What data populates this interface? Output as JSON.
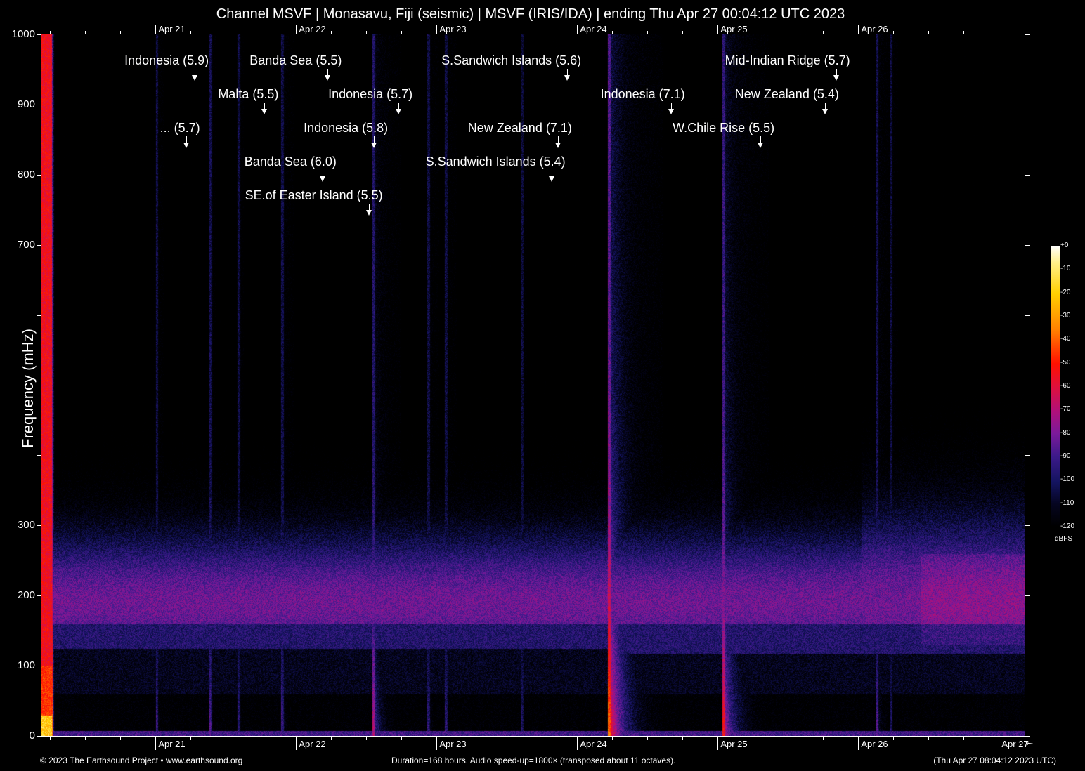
{
  "chart_data": {
    "type": "heatmap",
    "subtype": "spectrogram",
    "title": "Channel MSVF | Monasavu, Fiji (seismic) | MSVF (IRIS/IDA) | ending Thu Apr 27 00:04:12 UTC 2023",
    "ylabel": "Frequency (mHz)",
    "ylim": [
      0,
      1000
    ],
    "yticks": [
      0,
      100,
      200,
      300,
      400,
      500,
      600,
      700,
      800,
      900,
      1000
    ],
    "ytick_labels": [
      "0",
      "100",
      "200",
      "300",
      "",
      "",
      "",
      "700",
      "800",
      "900",
      "1000"
    ],
    "duration_hours": 168,
    "xticks_top": [
      "Apr 21",
      "Apr 22",
      "Apr 23",
      "Apr 24",
      "Apr 25",
      "Apr 26"
    ],
    "xticks_bottom": [
      "Apr 21",
      "Apr 22",
      "Apr 23",
      "Apr 24",
      "Apr 25",
      "Apr 26",
      "Apr 27"
    ],
    "xtick_hours": [
      19.6,
      43.6,
      67.6,
      91.6,
      115.6,
      139.6,
      163.6
    ],
    "colorbar": {
      "label": "dBFS",
      "range": [
        -120,
        0
      ],
      "ticks": [
        "+0",
        "-10",
        "-20",
        "-30",
        "-40",
        "-50",
        "-60",
        "-70",
        "-80",
        "-90",
        "-100",
        "-110",
        "-120"
      ]
    },
    "events": [
      {
        "label": "Indonesia (5.9)",
        "hour": 26.3
      },
      {
        "label": "Banda Sea (5.5)",
        "hour": 49.0
      },
      {
        "label": "S.Sandwich Islands (5.6)",
        "hour": 89.9
      },
      {
        "label": "Mid-Indian Ridge (5.7)",
        "hour": 135.8
      },
      {
        "label": "Malta (5.5)",
        "hour": 38.2
      },
      {
        "label": "Indonesia (5.7)",
        "hour": 61.1
      },
      {
        "label": "Indonesia (7.1)",
        "hour": 107.6
      },
      {
        "label": "New Zealand (5.4)",
        "hour": 133.9
      },
      {
        "label": "... (5.7)",
        "hour": 24.8
      },
      {
        "label": "Indonesia (5.8)",
        "hour": 56.9
      },
      {
        "label": "New Zealand (7.1)",
        "hour": 88.3
      },
      {
        "label": "W.Chile Rise (5.5)",
        "hour": 122.9
      },
      {
        "label": "Banda Sea (6.0)",
        "hour": 48.1
      },
      {
        "label": "S.Sandwich Islands (5.4)",
        "hour": 87.2
      },
      {
        "label": "SE.of Easter Island (5.5)",
        "hour": 56.0
      }
    ]
  },
  "footer": {
    "copyright": "© 2023 The Earthsound Project • www.earthsound.org",
    "info": "Duration=168 hours. Audio speed-up=1800× (transposed about 11 octaves).",
    "timestamp": "(Thu Apr 27 08:04:12 2023 UTC)"
  }
}
